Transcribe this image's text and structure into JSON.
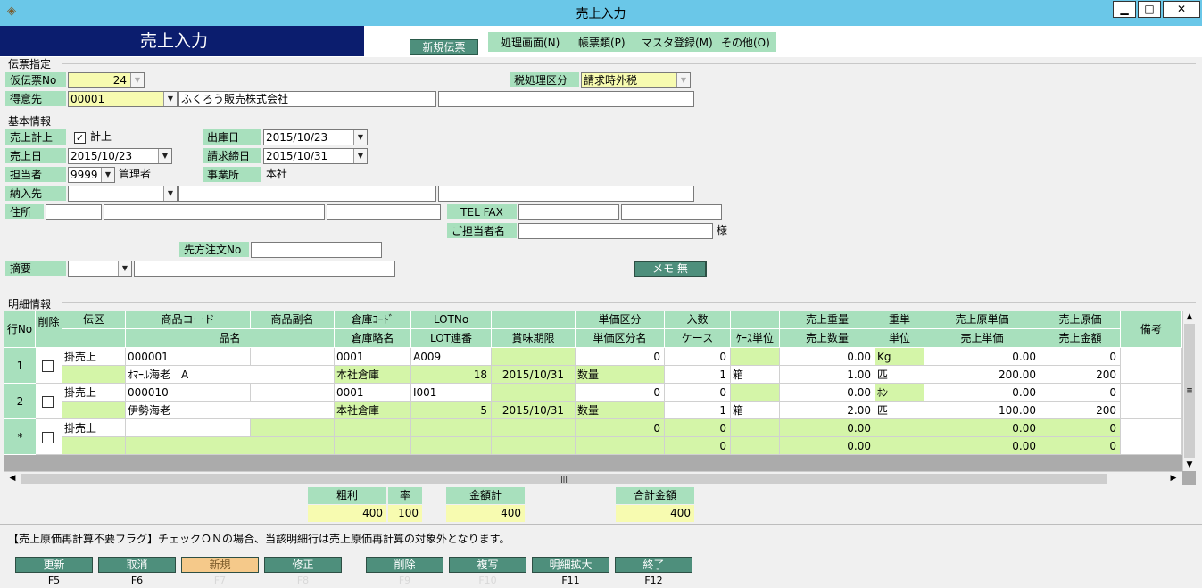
{
  "window": {
    "title": "売上入力",
    "min_label": "▁",
    "max_label": "□",
    "close_label": "✕"
  },
  "header": {
    "screen_title": "売上入力",
    "new_slip_label": "新規伝票"
  },
  "menu": [
    {
      "label": "処理画面(N)"
    },
    {
      "label": "帳票類(P)"
    },
    {
      "label": "マスタ登録(M)"
    },
    {
      "label": "その他(O)"
    }
  ],
  "slip": {
    "section_label": "伝票指定",
    "temp_no_label": "仮伝票No",
    "temp_no_value": "24",
    "tax_label": "税処理区分",
    "tax_value": "請求時外税",
    "customer_label": "得意先",
    "customer_code": "00001",
    "customer_name": "ふくろう販売株式会社",
    "customer_extra": ""
  },
  "basic": {
    "section_label": "基本情報",
    "sales_post_label": "売上計上",
    "sales_post_check_label": "計上",
    "sales_post_checked": true,
    "ship_date_label": "出庫日",
    "ship_date_value": "2015/10/23",
    "sales_date_label": "売上日",
    "sales_date_value": "2015/10/23",
    "bill_close_label": "請求締日",
    "bill_close_value": "2015/10/31",
    "staff_label": "担当者",
    "staff_code": "9999",
    "staff_name": "管理者",
    "office_label": "事業所",
    "office_value": "本社",
    "delivery_label": "納入先",
    "delivery_code": "",
    "delivery_name": "",
    "delivery_extra": "",
    "address_label": "住所",
    "zip": "",
    "address1": "",
    "address2": "",
    "tel_fax_label": "TEL FAX",
    "tel": "",
    "fax": "",
    "contact_label": "ご担当者名",
    "contact_value": "",
    "contact_suffix": "様",
    "order_no_label": "先方注文No",
    "order_no_value": "",
    "summary_label": "摘要",
    "summary_code": "",
    "summary_text": "",
    "memo_label": "メモ 無"
  },
  "details": {
    "section_label": "明細情報",
    "headers": {
      "row_no": "行No",
      "delete": "削除",
      "slip_type": "伝区",
      "product_code": "商品コード",
      "product_sub": "商品副名",
      "product_name": "品名",
      "warehouse_code": "倉庫ｺｰﾄﾞ",
      "warehouse_name": "倉庫略名",
      "lot_no": "LOTNo",
      "lot_seq": "LOT連番",
      "expiry": "賞味期限",
      "unit_price_type": "単価区分",
      "unit_price_type_name": "単価区分名",
      "pack_qty": "入数",
      "cases": "ケース",
      "case_unit": "ｹｰｽ単位",
      "sales_weight": "売上重量",
      "sales_qty": "売上数量",
      "weight_unit": "重単",
      "unit": "単位",
      "cost_unit_price": "売上原単価",
      "sales_unit_price": "売上単価",
      "cost_price": "売上原価",
      "sales_amount": "売上金額",
      "remarks": "備考"
    },
    "rows": [
      {
        "no": "1",
        "slip_type": "掛売上",
        "product_code": "000001",
        "product_sub": "",
        "product_name": "ｵﾏｰﾙ海老　A",
        "warehouse_code": "0001",
        "warehouse_name": "本社倉庫",
        "lot_no": "A009",
        "lot_seq": "18",
        "expiry": "2015/10/31",
        "unit_price_type": "0",
        "unit_price_type_name": "数量",
        "pack_qty": "0",
        "cases": "1",
        "case_unit": "箱",
        "sales_weight": "0.00",
        "sales_qty": "1.00",
        "weight_unit": "Kg",
        "unit": "匹",
        "cost_unit_price": "0.00",
        "sales_unit_price": "200.00",
        "cost_price": "0",
        "sales_amount": "200"
      },
      {
        "no": "2",
        "slip_type": "掛売上",
        "product_code": "000010",
        "product_sub": "",
        "product_name": "伊勢海老",
        "warehouse_code": "0001",
        "warehouse_name": "本社倉庫",
        "lot_no": "I001",
        "lot_seq": "5",
        "expiry": "2015/10/31",
        "unit_price_type": "0",
        "unit_price_type_name": "数量",
        "pack_qty": "0",
        "cases": "1",
        "case_unit": "箱",
        "sales_weight": "0.00",
        "sales_qty": "2.00",
        "weight_unit": "ﾎﾝ",
        "unit": "匹",
        "cost_unit_price": "0.00",
        "sales_unit_price": "100.00",
        "cost_price": "0",
        "sales_amount": "200"
      }
    ],
    "new_row": {
      "no": "*",
      "slip_type": "掛売上",
      "unit_price_type": "0",
      "pack_qty": "0",
      "cases": "0",
      "sales_weight": "0.00",
      "sales_qty": "0.00",
      "cost_unit_price": "0.00",
      "sales_unit_price": "0.00",
      "cost_price": "0",
      "sales_amount": "0"
    },
    "hscroll_grip": "|||"
  },
  "totals": {
    "gross_label": "粗利",
    "gross_value": "400",
    "rate_label": "率",
    "rate_value": "100",
    "amount_label": "金額計",
    "amount_value": "400",
    "grand_label": "合計金額",
    "grand_value": "400"
  },
  "message": "【売上原価再計算不要フラグ】チェックＯＮの場合、当該明細行は売上原価再計算の対象外となります。",
  "function_buttons": [
    {
      "label": "更新",
      "key": "F5"
    },
    {
      "label": "取消",
      "key": "F6"
    },
    {
      "label": "新規",
      "key": "F7"
    },
    {
      "label": "修正",
      "key": "F8"
    },
    {
      "label": "削除",
      "key": "F9"
    },
    {
      "label": "複写",
      "key": "F10"
    },
    {
      "label": "明細拡大",
      "key": "F11"
    },
    {
      "label": "終了",
      "key": "F12"
    }
  ],
  "colors": {
    "title_bar": "#6ac7e8",
    "header_navy": "#0b1d6e",
    "label_green": "#a8e0bd",
    "button_teal": "#4e8f7c",
    "input_yellow": "#f7fbb0"
  }
}
